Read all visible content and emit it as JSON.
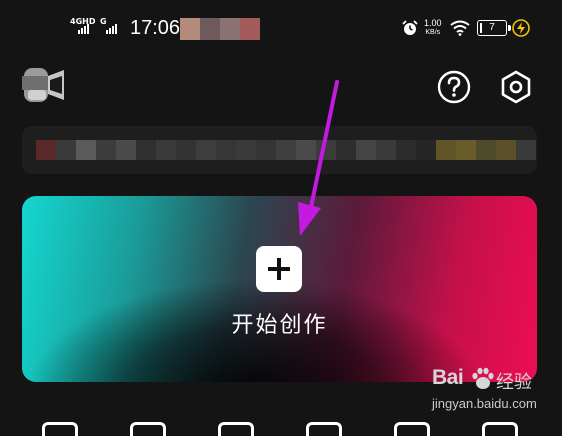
{
  "status_bar": {
    "network_primary": "4GHD",
    "network_secondary": "G",
    "time": "17:06",
    "speed_value": "1.00",
    "speed_unit": "KB/s",
    "battery_level": "7",
    "battery_fraction": 0.07
  },
  "header": {
    "avatar_icon": "blurred-avatar-icon",
    "help_icon": "help-circle-icon",
    "settings_icon": "hexagon-gear-icon"
  },
  "notice": {
    "content": "blurred-notice-content"
  },
  "create_card": {
    "label": "开始创作",
    "icon": "plus-icon",
    "gradient_colors": [
      "#15d7d0",
      "#2b4750",
      "#ee0d55"
    ]
  },
  "annotation": {
    "arrow_color": "#c41ae0"
  },
  "toolbar": {
    "icons": [
      "tool-icon-1",
      "tool-icon-2",
      "tool-icon-3",
      "tool-icon-4",
      "tool-icon-5",
      "tool-icon-6"
    ]
  },
  "watermark": {
    "brand": "Bai",
    "brand_cn": "经验",
    "url": "jingyan.baidu.com"
  }
}
